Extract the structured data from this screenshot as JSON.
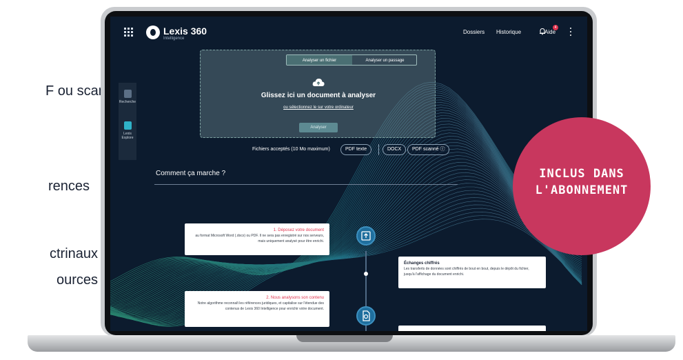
{
  "side_text": {
    "line1": "F ou scan.",
    "line2": "rences",
    "line3": "ctrinaux",
    "line4": "ources"
  },
  "app": {
    "logo_name": "Lexis 360",
    "logo_sub": "Intelligence",
    "nav": {
      "dossiers": "Dossiers",
      "historique": "Historique",
      "aide": "Aide"
    },
    "notification_badge": "4",
    "icons": [
      "apps-grid-icon",
      "bell-icon",
      "kebab-menu-icon",
      "cloud-upload-icon",
      "upload-icon",
      "document-scan-icon"
    ]
  },
  "rail": {
    "items": [
      {
        "label": "Recherche"
      },
      {
        "label": "Lexis Explore"
      }
    ]
  },
  "upload": {
    "tabs": [
      "Analyser un fichier",
      "Analyser un passage"
    ],
    "drop_title": "Glissez ici un document à analyser",
    "drop_link": "ou sélectionnez le sur votre ordinateur",
    "analyze_button": "Analyser"
  },
  "accepted": {
    "label": "Fichiers acceptés (10 Mo maximum)",
    "formats": [
      "PDF texte",
      "DOCX",
      "PDF scanné ⓘ"
    ]
  },
  "how": {
    "title": "Comment ça marche ?"
  },
  "steps": [
    {
      "title": "1. Déposez votre document",
      "body": "au format Microsoft Word (.docx) ou PDF. Il ne sera pas enregistré sur nos serveurs, mais uniquement analysé pour être enrichi."
    },
    {
      "title": "Échanges chiffrés",
      "body": "Les transferts de données sont chiffrés de bout en bout, depuis le dépôt du fichier, jusqu'à l'affichage du document enrichi."
    },
    {
      "title": "2. Nous analysons son contenu",
      "body": "Notre algorithme reconnaît les références juridiques, et capitalise sur l'étendue des contenus de Lexis 360 Intelligence pour enrichir votre document."
    }
  ],
  "stamp": {
    "line1": "INCLUS DANS",
    "line2": "L'ABONNEMENT"
  },
  "colors": {
    "screen_bg": "#0c1b2e",
    "accent_red": "#e0344f",
    "stamp": "#c8375e",
    "wave_green": "#3fd6a0",
    "wave_teal": "#2fb3c9"
  }
}
